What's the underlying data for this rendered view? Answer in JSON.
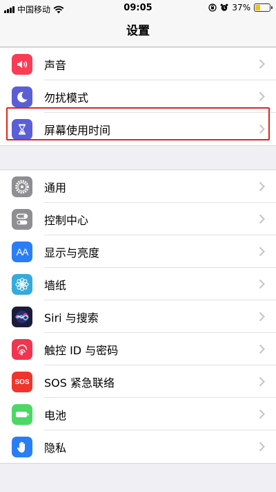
{
  "status_bar": {
    "carrier": "中国移动",
    "time": "09:05",
    "battery_percent": "37%",
    "battery_level": 0.37,
    "icons": [
      "signal-icon",
      "wifi-icon",
      "orientation-lock-icon",
      "alarm-icon",
      "battery-icon"
    ]
  },
  "nav": {
    "title": "设置"
  },
  "groups": [
    {
      "items": [
        {
          "label": "声音",
          "icon": "speaker-icon",
          "color": "#fa3c54"
        },
        {
          "label": "勿扰模式",
          "icon": "moon-icon",
          "color": "#5b5fd6"
        },
        {
          "label": "屏幕使用时间",
          "icon": "hourglass-icon",
          "color": "#5b5fd6"
        }
      ]
    },
    {
      "items": [
        {
          "label": "通用",
          "icon": "gear-icon",
          "color": "#8e8e93"
        },
        {
          "label": "控制中心",
          "icon": "toggles-icon",
          "color": "#8e8e93"
        },
        {
          "label": "显示与亮度",
          "icon": "text-size-icon",
          "color": "#2a7ef5"
        },
        {
          "label": "墙纸",
          "icon": "flower-icon",
          "color": "#35aadc"
        },
        {
          "label": "Siri 与搜索",
          "icon": "siri-icon",
          "color": "#1b1b3a"
        },
        {
          "label": "触控 ID 与密码",
          "icon": "fingerprint-icon",
          "color": "#f1354e"
        },
        {
          "label": "SOS 紧急联络",
          "icon": "sos-icon",
          "color": "#f0352c"
        },
        {
          "label": "电池",
          "icon": "battery-app-icon",
          "color": "#4cd864"
        },
        {
          "label": "隐私",
          "icon": "hand-icon",
          "color": "#2a7ef5"
        }
      ]
    }
  ],
  "icon_texts": {
    "display": "AA",
    "sos": "SOS"
  }
}
